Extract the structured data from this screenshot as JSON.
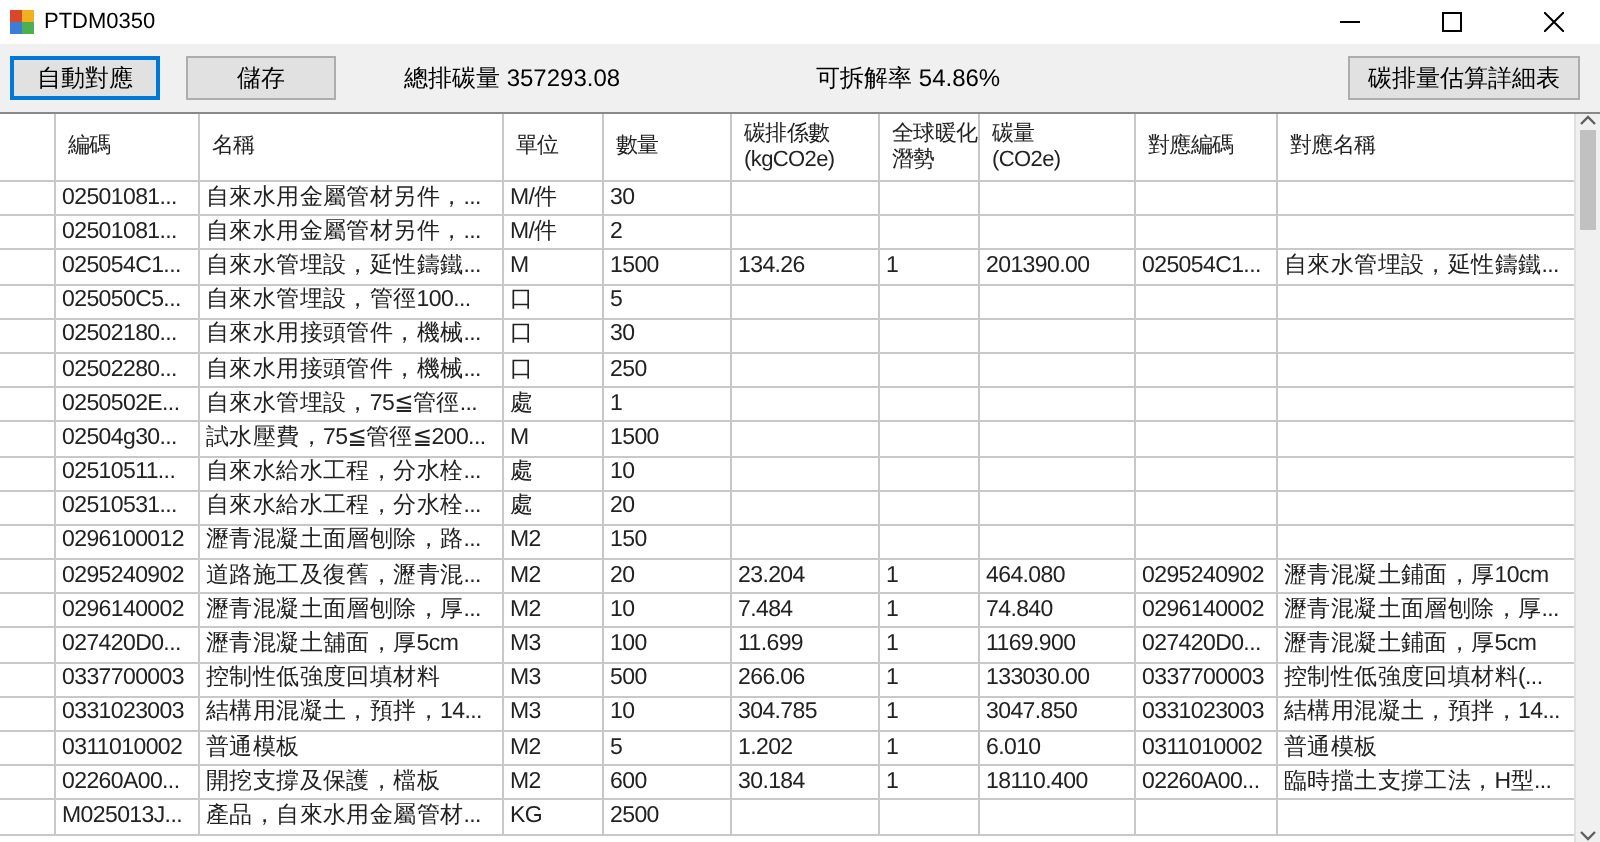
{
  "window": {
    "title": "PTDM0350"
  },
  "toolbar": {
    "buttons": [
      {
        "label": "自動對應",
        "focused": true
      },
      {
        "label": "儲存",
        "focused": false
      }
    ],
    "total_label": "總排碳量 357293.08",
    "rate_label": "可拆解率 54.86%",
    "detail_button": "碳排量估算詳細表"
  },
  "table": {
    "columns": [
      {
        "lines": [
          "編碼"
        ]
      },
      {
        "lines": [
          "名稱"
        ]
      },
      {
        "lines": [
          "單位"
        ]
      },
      {
        "lines": [
          "數量"
        ]
      },
      {
        "lines": [
          "碳排係數",
          "(kgCO2e)"
        ]
      },
      {
        "lines": [
          "全球暖化",
          "潛勢"
        ]
      },
      {
        "lines": [
          "碳量",
          "(CO2e)"
        ]
      },
      {
        "lines": [
          "對應編碼"
        ]
      },
      {
        "lines": [
          "對應名稱"
        ]
      }
    ],
    "rows": [
      [
        "02501081...",
        "自來水用金屬管材另件，...",
        "M/件",
        "30",
        "",
        "",
        "",
        "",
        ""
      ],
      [
        "02501081...",
        "自來水用金屬管材另件，...",
        "M/件",
        "2",
        "",
        "",
        "",
        "",
        ""
      ],
      [
        "025054C1...",
        "自來水管埋設，延性鑄鐵...",
        "M",
        "1500",
        "134.26",
        "1",
        "201390.00",
        "025054C1...",
        "自來水管埋設，延性鑄鐵..."
      ],
      [
        "025050C5...",
        "自來水管埋設，管徑100...",
        "口",
        "5",
        "",
        "",
        "",
        "",
        ""
      ],
      [
        "02502180...",
        "自來水用接頭管件，機械...",
        "口",
        "30",
        "",
        "",
        "",
        "",
        ""
      ],
      [
        "02502280...",
        "自來水用接頭管件，機械...",
        "口",
        "250",
        "",
        "",
        "",
        "",
        ""
      ],
      [
        "0250502E...",
        "自來水管埋設，75≦管徑...",
        "處",
        "1",
        "",
        "",
        "",
        "",
        ""
      ],
      [
        "02504g30...",
        "試水壓費，75≦管徑≦200...",
        "M",
        "1500",
        "",
        "",
        "",
        "",
        ""
      ],
      [
        "02510511...",
        "自來水給水工程，分水栓...",
        "處",
        "10",
        "",
        "",
        "",
        "",
        ""
      ],
      [
        "02510531...",
        "自來水給水工程，分水栓...",
        "處",
        "20",
        "",
        "",
        "",
        "",
        ""
      ],
      [
        "0296100012",
        "瀝青混凝土面層刨除，路...",
        "M2",
        "150",
        "",
        "",
        "",
        "",
        ""
      ],
      [
        "0295240902",
        "道路施工及復舊，瀝青混...",
        "M2",
        "20",
        "23.204",
        "1",
        "464.080",
        "0295240902",
        "瀝青混凝土鋪面，厚10cm"
      ],
      [
        "0296140002",
        "瀝青混凝土面層刨除，厚...",
        "M2",
        "10",
        "7.484",
        "1",
        "74.840",
        "0296140002",
        "瀝青混凝土面層刨除，厚..."
      ],
      [
        "027420D0...",
        "瀝青混凝土舖面，厚5cm",
        "M3",
        "100",
        "11.699",
        "1",
        "1169.900",
        "027420D0...",
        "瀝青混凝土鋪面，厚5cm"
      ],
      [
        "0337700003",
        "控制性低強度回填材料",
        "M3",
        "500",
        "266.06",
        "1",
        "133030.00",
        "0337700003",
        "控制性低強度回填材料(..."
      ],
      [
        "0331023003",
        "結構用混凝土，預拌，14...",
        "M3",
        "10",
        "304.785",
        "1",
        "3047.850",
        "0331023003",
        "結構用混凝土，預拌，14..."
      ],
      [
        "0311010002",
        "普通模板",
        "M2",
        "5",
        "1.202",
        "1",
        "6.010",
        "0311010002",
        "普通模板"
      ],
      [
        "02260A00...",
        "開挖支撐及保護，檔板",
        "M2",
        "600",
        "30.184",
        "1",
        "18110.400",
        "02260A00...",
        "臨時擋土支撐工法，H型..."
      ],
      [
        "M025013J...",
        "產品，自來水用金屬管材...",
        "KG",
        "2500",
        "",
        "",
        "",
        "",
        ""
      ]
    ]
  }
}
